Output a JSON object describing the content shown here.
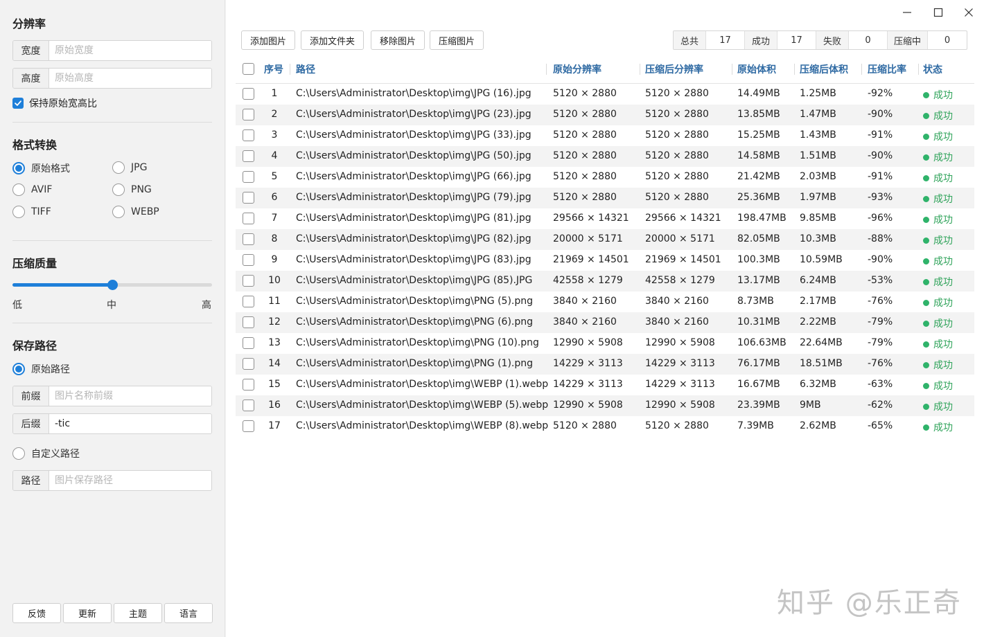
{
  "sidebar": {
    "resolution": {
      "title": "分辨率",
      "width_label": "宽度",
      "width_placeholder": "原始宽度",
      "height_label": "高度",
      "height_placeholder": "原始高度",
      "keep_ratio_label": "保持原始宽高比",
      "keep_ratio_checked": true
    },
    "format": {
      "title": "格式转换",
      "options": [
        "原始格式",
        "JPG",
        "AVIF",
        "PNG",
        "TIFF",
        "WEBP"
      ],
      "selected": "原始格式"
    },
    "quality": {
      "title": "压缩质量",
      "low": "低",
      "mid": "中",
      "high": "高",
      "value": 0.5
    },
    "save": {
      "title": "保存路径",
      "original_path_label": "原始路径",
      "prefix_label": "前缀",
      "prefix_placeholder": "图片名称前缀",
      "prefix_value": "",
      "suffix_label": "后缀",
      "suffix_value": "-tic",
      "custom_path_label": "自定义路径",
      "path_label": "路径",
      "path_placeholder": "图片保存路径"
    },
    "buttons": [
      "反馈",
      "更新",
      "主题",
      "语言"
    ]
  },
  "toolbar": {
    "add_images": "添加图片",
    "add_folder": "添加文件夹",
    "remove_images": "移除图片",
    "compress_images": "压缩图片"
  },
  "stats": {
    "total_label": "总共",
    "total": "17",
    "success_label": "成功",
    "success": "17",
    "fail_label": "失败",
    "fail": "0",
    "compressing_label": "压缩中",
    "compressing": "0"
  },
  "table": {
    "headers": [
      "序号",
      "路径",
      "原始分辨率",
      "压缩后分辨率",
      "原始体积",
      "压缩后体积",
      "压缩比率",
      "状态"
    ],
    "rows": [
      [
        "1",
        "C:\\Users\\Administrator\\Desktop\\img\\JPG (16).jpg",
        "5120 × 2880",
        "5120 × 2880",
        "14.49MB",
        "1.25MB",
        "-92%",
        "成功"
      ],
      [
        "2",
        "C:\\Users\\Administrator\\Desktop\\img\\JPG (23).jpg",
        "5120 × 2880",
        "5120 × 2880",
        "13.85MB",
        "1.47MB",
        "-90%",
        "成功"
      ],
      [
        "3",
        "C:\\Users\\Administrator\\Desktop\\img\\JPG (33).jpg",
        "5120 × 2880",
        "5120 × 2880",
        "15.25MB",
        "1.43MB",
        "-91%",
        "成功"
      ],
      [
        "4",
        "C:\\Users\\Administrator\\Desktop\\img\\JPG (50).jpg",
        "5120 × 2880",
        "5120 × 2880",
        "14.58MB",
        "1.51MB",
        "-90%",
        "成功"
      ],
      [
        "5",
        "C:\\Users\\Administrator\\Desktop\\img\\JPG (66).jpg",
        "5120 × 2880",
        "5120 × 2880",
        "21.42MB",
        "2.03MB",
        "-91%",
        "成功"
      ],
      [
        "6",
        "C:\\Users\\Administrator\\Desktop\\img\\JPG (79).jpg",
        "5120 × 2880",
        "5120 × 2880",
        "25.36MB",
        "1.97MB",
        "-93%",
        "成功"
      ],
      [
        "7",
        "C:\\Users\\Administrator\\Desktop\\img\\JPG (81).jpg",
        "29566 × 14321",
        "29566 × 14321",
        "198.47MB",
        "9.85MB",
        "-96%",
        "成功"
      ],
      [
        "8",
        "C:\\Users\\Administrator\\Desktop\\img\\JPG (82).jpg",
        "20000 × 5171",
        "20000 × 5171",
        "82.05MB",
        "10.3MB",
        "-88%",
        "成功"
      ],
      [
        "9",
        "C:\\Users\\Administrator\\Desktop\\img\\JPG (83).jpg",
        "21969 × 14501",
        "21969 × 14501",
        "100.3MB",
        "10.59MB",
        "-90%",
        "成功"
      ],
      [
        "10",
        "C:\\Users\\Administrator\\Desktop\\img\\JPG (85).JPG",
        "42558 × 1279",
        "42558 × 1279",
        "13.17MB",
        "6.24MB",
        "-53%",
        "成功"
      ],
      [
        "11",
        "C:\\Users\\Administrator\\Desktop\\img\\PNG (5).png",
        "3840 × 2160",
        "3840 × 2160",
        "8.73MB",
        "2.17MB",
        "-76%",
        "成功"
      ],
      [
        "12",
        "C:\\Users\\Administrator\\Desktop\\img\\PNG (6).png",
        "3840 × 2160",
        "3840 × 2160",
        "10.31MB",
        "2.22MB",
        "-79%",
        "成功"
      ],
      [
        "13",
        "C:\\Users\\Administrator\\Desktop\\img\\PNG (10).png",
        "12990 × 5908",
        "12990 × 5908",
        "106.63MB",
        "22.64MB",
        "-79%",
        "成功"
      ],
      [
        "14",
        "C:\\Users\\Administrator\\Desktop\\img\\PNG (1).png",
        "14229 × 3113",
        "14229 × 3113",
        "76.17MB",
        "18.51MB",
        "-76%",
        "成功"
      ],
      [
        "15",
        "C:\\Users\\Administrator\\Desktop\\img\\WEBP (1).webp",
        "14229 × 3113",
        "14229 × 3113",
        "16.67MB",
        "6.32MB",
        "-63%",
        "成功"
      ],
      [
        "16",
        "C:\\Users\\Administrator\\Desktop\\img\\WEBP (5).webp",
        "12990 × 5908",
        "12990 × 5908",
        "23.39MB",
        "9MB",
        "-62%",
        "成功"
      ],
      [
        "17",
        "C:\\Users\\Administrator\\Desktop\\img\\WEBP (8).webp",
        "5120 × 2880",
        "5120 × 2880",
        "7.39MB",
        "2.62MB",
        "-65%",
        "成功"
      ]
    ]
  },
  "watermark": "知乎 @乐正奇",
  "colors": {
    "accent": "#1e7fd9",
    "header_text": "#2f6aa3",
    "success": "#2fa35a"
  }
}
